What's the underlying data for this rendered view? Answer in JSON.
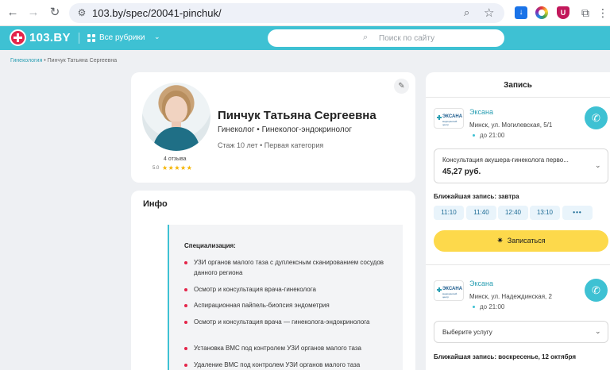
{
  "browser": {
    "url": "103.by/spec/20041-pinchuk/"
  },
  "site": {
    "logo": "103.BY",
    "rubrics": "Все рубрики",
    "search_placeholder": "Поиск по сайту"
  },
  "breadcrumb": {
    "parent": "Гинекология",
    "separator": "•",
    "current": "Пинчук Татьяна Сергеевна"
  },
  "doctor": {
    "name": "Пинчук Татьяна Сергеевна",
    "specialty": "Гинеколог • Гинеколог-эндокринолог",
    "experience": "Стаж 10 лет  •  Первая категория",
    "reviews": "4 отзыва",
    "rating": "5.0",
    "stars": "★★★★★"
  },
  "info": {
    "title": "Инфо",
    "heading": "Специализация:",
    "items": [
      "УЗИ органов малого таза с дуплексным сканированием сосудов данного региона",
      "Осмотр и консультация врача-гинеколога",
      "Аспирационная пайпель-биопсия эндометрия",
      "Осмотр и консультация врача — гинеколога-эндокринолога",
      "Установка ВМС под контролем УЗИ органов малого таза",
      "Удаление ВМС под контролем УЗИ органов малого таза"
    ]
  },
  "booking": {
    "title": "Запись",
    "clinics": [
      {
        "logo_name": "ЭКСАНА",
        "logo_sub": "медицинский центр",
        "name": "Эксана",
        "address": "Минск, ул. Могилевская, 5/1",
        "hours": "до 21:00",
        "service": "Консультация акушера-гинеколога перво...",
        "price": "45,27 руб.",
        "nearest": "Ближайшая запись: завтра",
        "slots": [
          "11:10",
          "11:40",
          "12:40",
          "13:10",
          "•••"
        ],
        "book_label": "Записаться"
      },
      {
        "logo_name": "ЭКСАНА",
        "logo_sub": "медицинский центр",
        "name": "Эксана",
        "address": "Минск, ул. Надеждинская, 2",
        "hours": "до 21:00",
        "service": "Выберите услугу",
        "nearest": "Ближайшая запись: воскресенье, 12 октября"
      }
    ]
  },
  "colors": {
    "brand": "#3ec1d3",
    "logo_red": "#e4254a",
    "book_button": "#fdd94b",
    "link": "#2a9fb3"
  }
}
